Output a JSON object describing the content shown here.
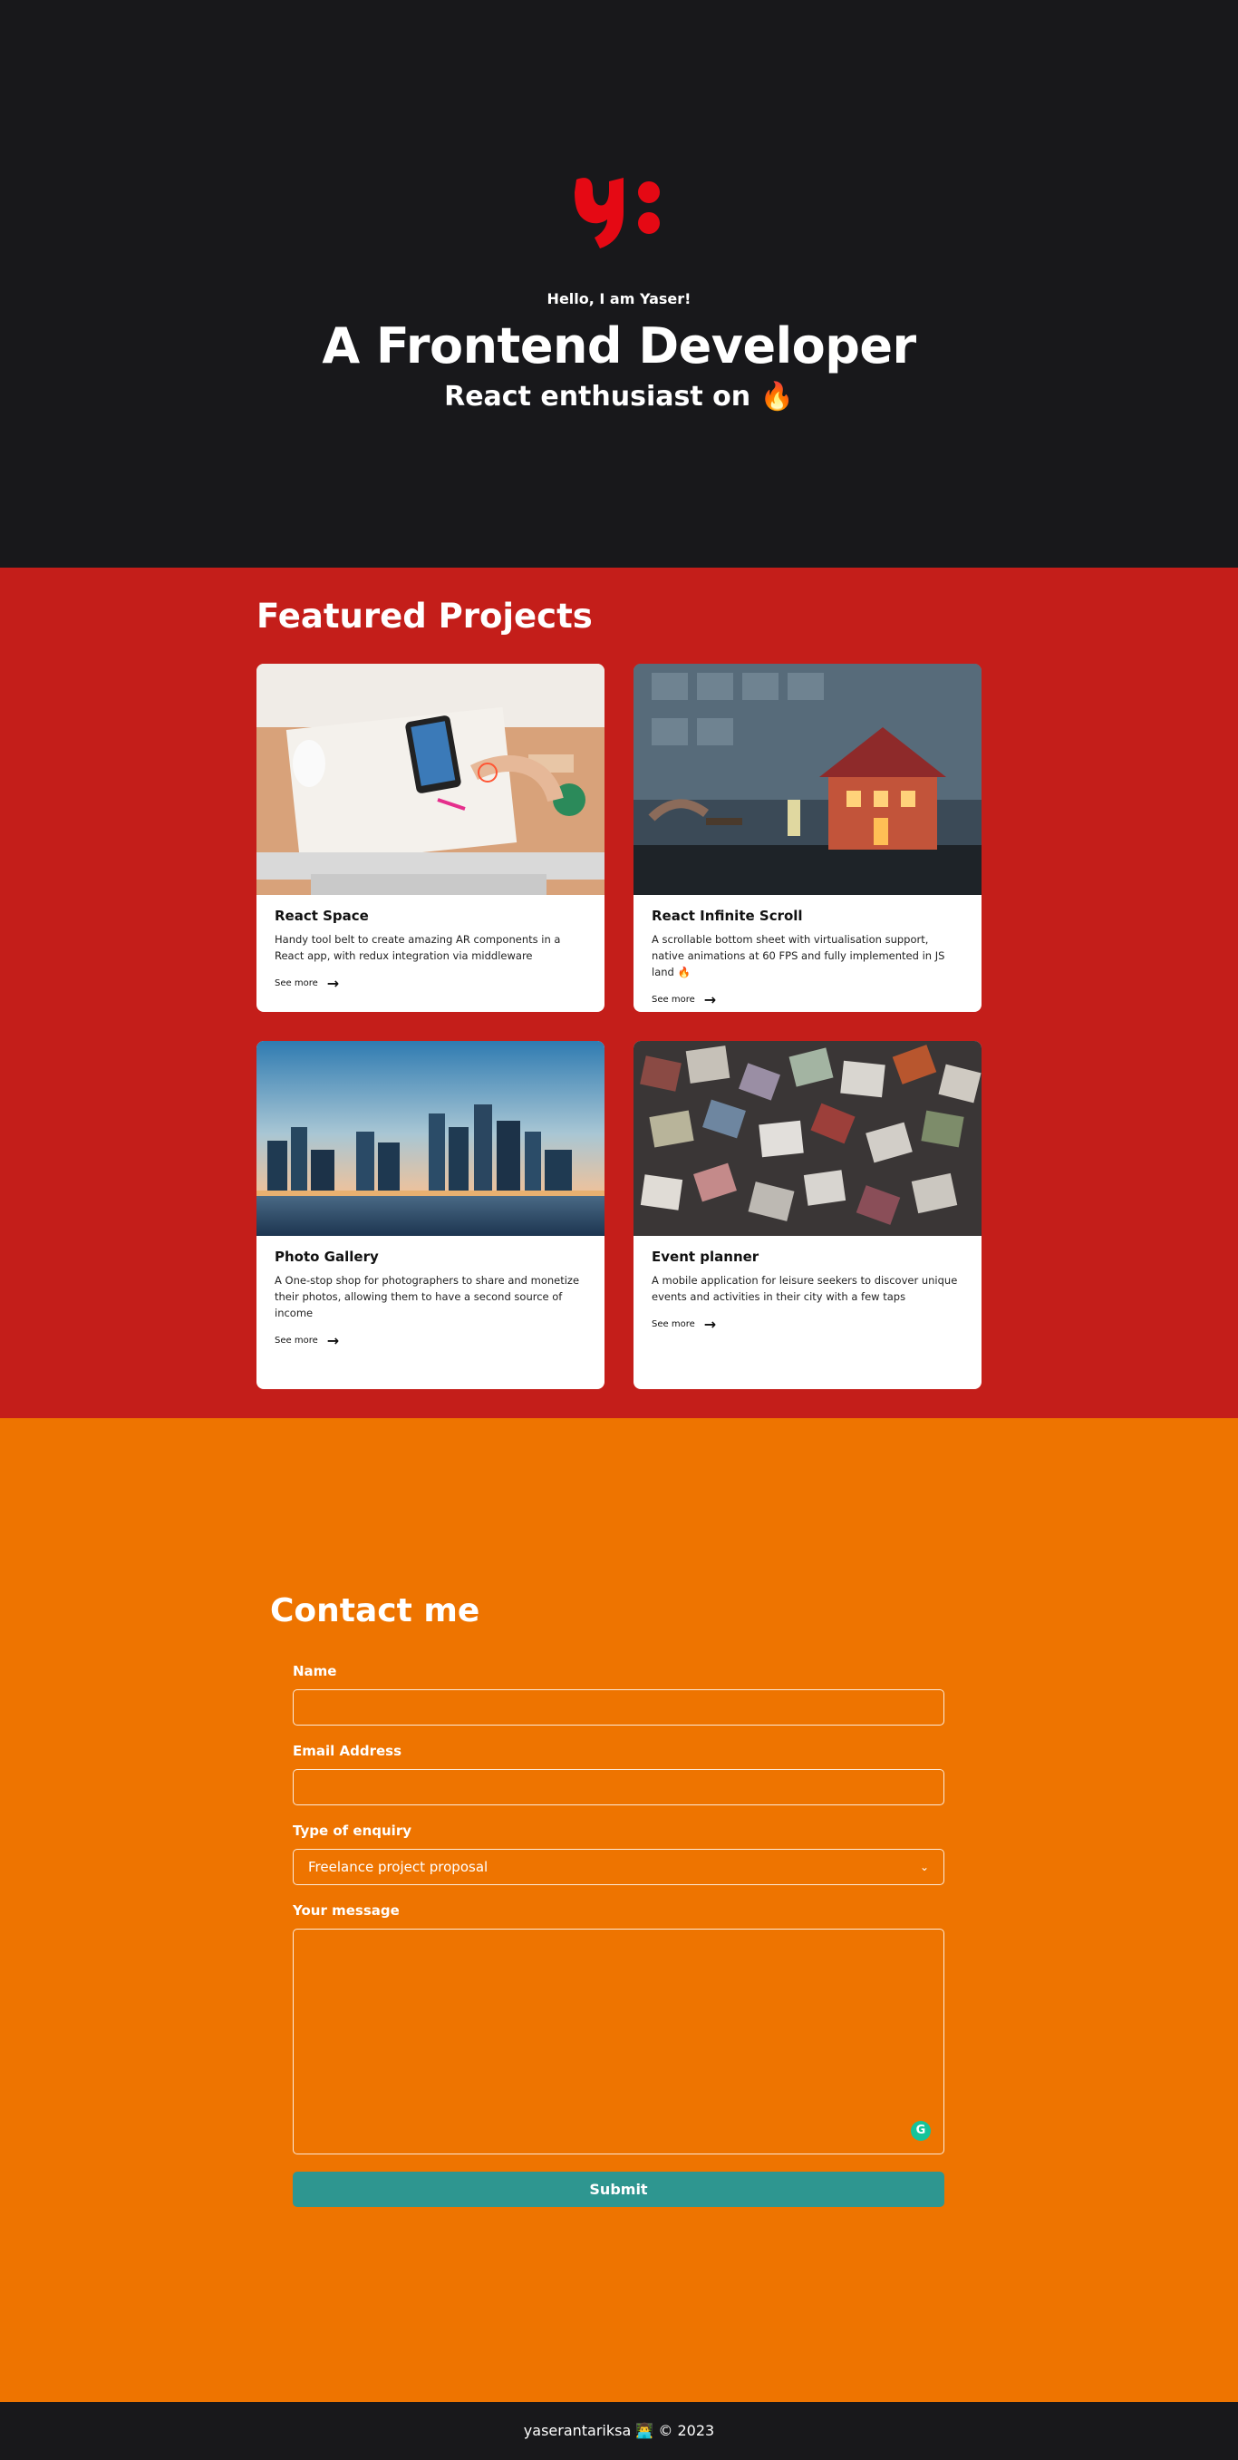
{
  "hero": {
    "greeting": "Hello, I am Yaser!",
    "headline": "A Frontend Developer",
    "subheadline": "React enthusiast on 🔥",
    "logo_color": "#e50914"
  },
  "projects": {
    "heading": "Featured Projects",
    "items": [
      {
        "title": "React Space",
        "description": "Handy tool belt to create amazing AR components in a React app, with redux integration via middleware",
        "link_label": "See more"
      },
      {
        "title": "React Infinite Scroll",
        "description": "A scrollable bottom sheet with virtualisation support, native animations at 60 FPS and fully implemented in JS land 🔥",
        "link_label": "See more"
      },
      {
        "title": "Photo Gallery",
        "description": "A One-stop shop for photographers to share and monetize their photos, allowing them to have a second source of income",
        "link_label": "See more"
      },
      {
        "title": "Event planner",
        "description": "A mobile application for leisure seekers to discover unique events and activities in their city with a few taps",
        "link_label": "See more"
      }
    ]
  },
  "contact": {
    "heading": "Contact me",
    "name_label": "Name",
    "name_value": "",
    "email_label": "Email Address",
    "email_value": "",
    "enquiry_label": "Type of enquiry",
    "enquiry_selected": "Freelance project proposal",
    "message_label": "Your message",
    "message_value": "",
    "submit_label": "Submit"
  },
  "footer": {
    "text": "yaserantariksa 👨‍💻 © 2023"
  },
  "colors": {
    "hero_bg": "#18181b",
    "projects_bg": "#c41e1a",
    "contact_bg": "#ee7400",
    "submit_bg": "#2e9690"
  }
}
